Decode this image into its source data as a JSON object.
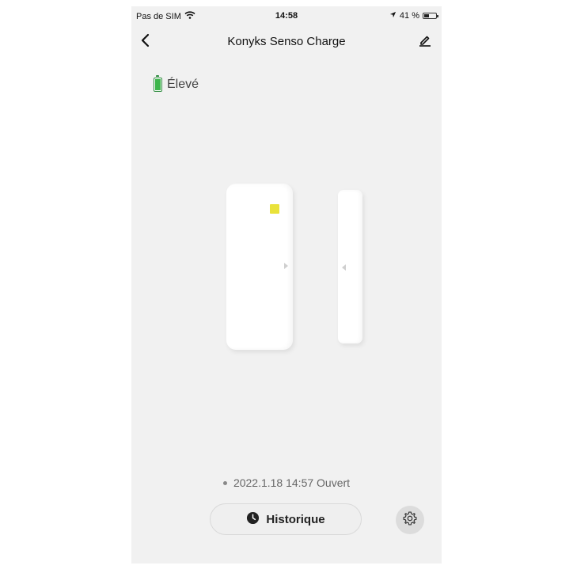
{
  "status_bar": {
    "carrier": "Pas de SIM",
    "time": "14:58",
    "battery_percent": "41 %"
  },
  "nav": {
    "title": "Konyks Senso Charge",
    "back_icon": "chevron-left-icon",
    "edit_icon": "pencil-icon"
  },
  "battery": {
    "label": "Élevé",
    "icon": "battery-full-icon",
    "color": "#3cb54a"
  },
  "sensor": {
    "led_color": "#e9e23a"
  },
  "last_event": {
    "text": "2022.1.18 14:57 Ouvert"
  },
  "actions": {
    "history_label": "Historique",
    "history_icon": "clock-icon",
    "settings_icon": "gear-icon"
  }
}
